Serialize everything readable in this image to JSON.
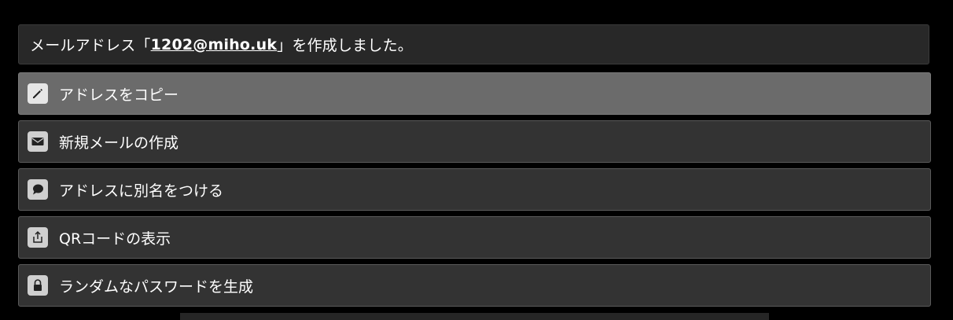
{
  "notice": {
    "prefix": "メールアドレス「",
    "address": "1202@miho.uk",
    "suffix": "」を作成しました。"
  },
  "menu": {
    "items": [
      {
        "label": "アドレスをコピー",
        "icon": "pencil-icon"
      },
      {
        "label": "新規メールの作成",
        "icon": "envelope-icon"
      },
      {
        "label": "アドレスに別名をつける",
        "icon": "speech-bubble-icon"
      },
      {
        "label": "QRコードの表示",
        "icon": "share-icon"
      },
      {
        "label": "ランダムなパスワードを生成",
        "icon": "lock-icon"
      }
    ]
  },
  "colors": {
    "background": "#000000",
    "notice_bg": "#282828",
    "item_bg": "#333333",
    "item_active_bg": "#6b6b6b",
    "icon_bg": "#cfcfcf"
  }
}
